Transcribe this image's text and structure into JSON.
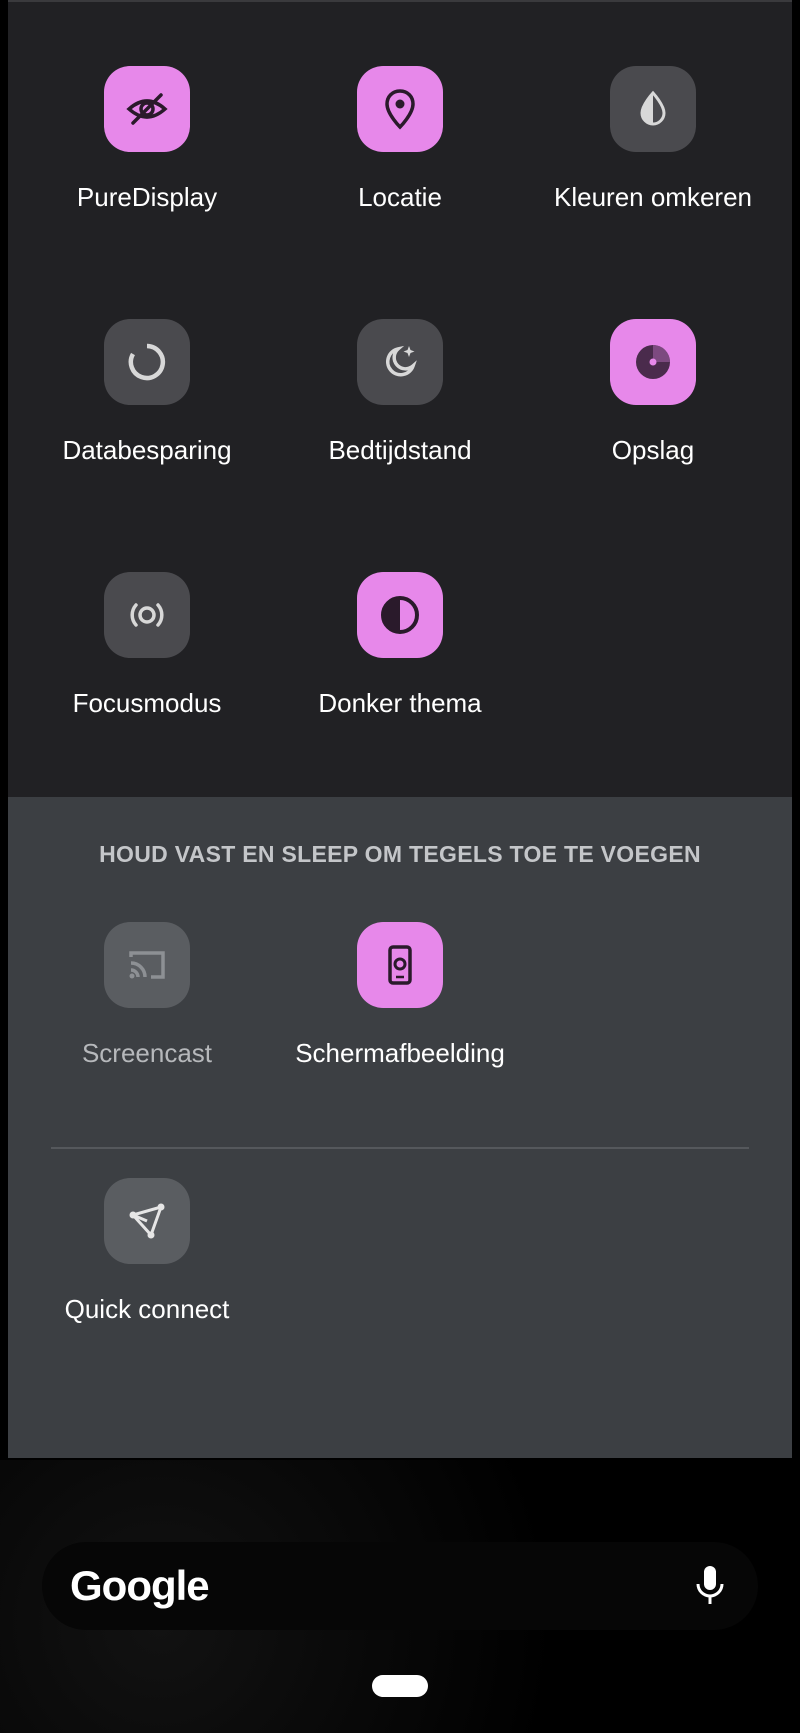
{
  "active_tiles": [
    {
      "label": "PureDisplay",
      "icon": "eye-display-icon",
      "state": "on"
    },
    {
      "label": "Locatie",
      "icon": "location-pin-icon",
      "state": "on"
    },
    {
      "label": "Kleuren omkeren",
      "icon": "invert-colors-icon",
      "state": "off"
    },
    {
      "label": "Databesparing",
      "icon": "data-saver-icon",
      "state": "off"
    },
    {
      "label": "Bedtijdstand",
      "icon": "bedtime-moon-icon",
      "state": "off"
    },
    {
      "label": "Opslag",
      "icon": "storage-pie-icon",
      "state": "on"
    },
    {
      "label": "Focusmodus",
      "icon": "focus-mode-icon",
      "state": "off"
    },
    {
      "label": "Donker thema",
      "icon": "dark-theme-icon",
      "state": "on"
    }
  ],
  "available": {
    "hint": "HOUD VAST EN SLEEP OM TEGELS TOE TE VOEGEN",
    "tiles": [
      {
        "label": "Screencast",
        "icon": "cast-icon",
        "state": "unavailable"
      },
      {
        "label": "Schermafbeelding",
        "icon": "screenshot-icon",
        "state": "on"
      },
      {
        "label": "Quick connect",
        "icon": "quick-connect-icon",
        "state": "off"
      }
    ]
  },
  "search_bar": {
    "logo": "Google",
    "mic_icon": "microphone-icon"
  },
  "colors": {
    "accent": "#e788ea",
    "panel_dark": "#212124",
    "panel_gray": "#3c3f43"
  }
}
